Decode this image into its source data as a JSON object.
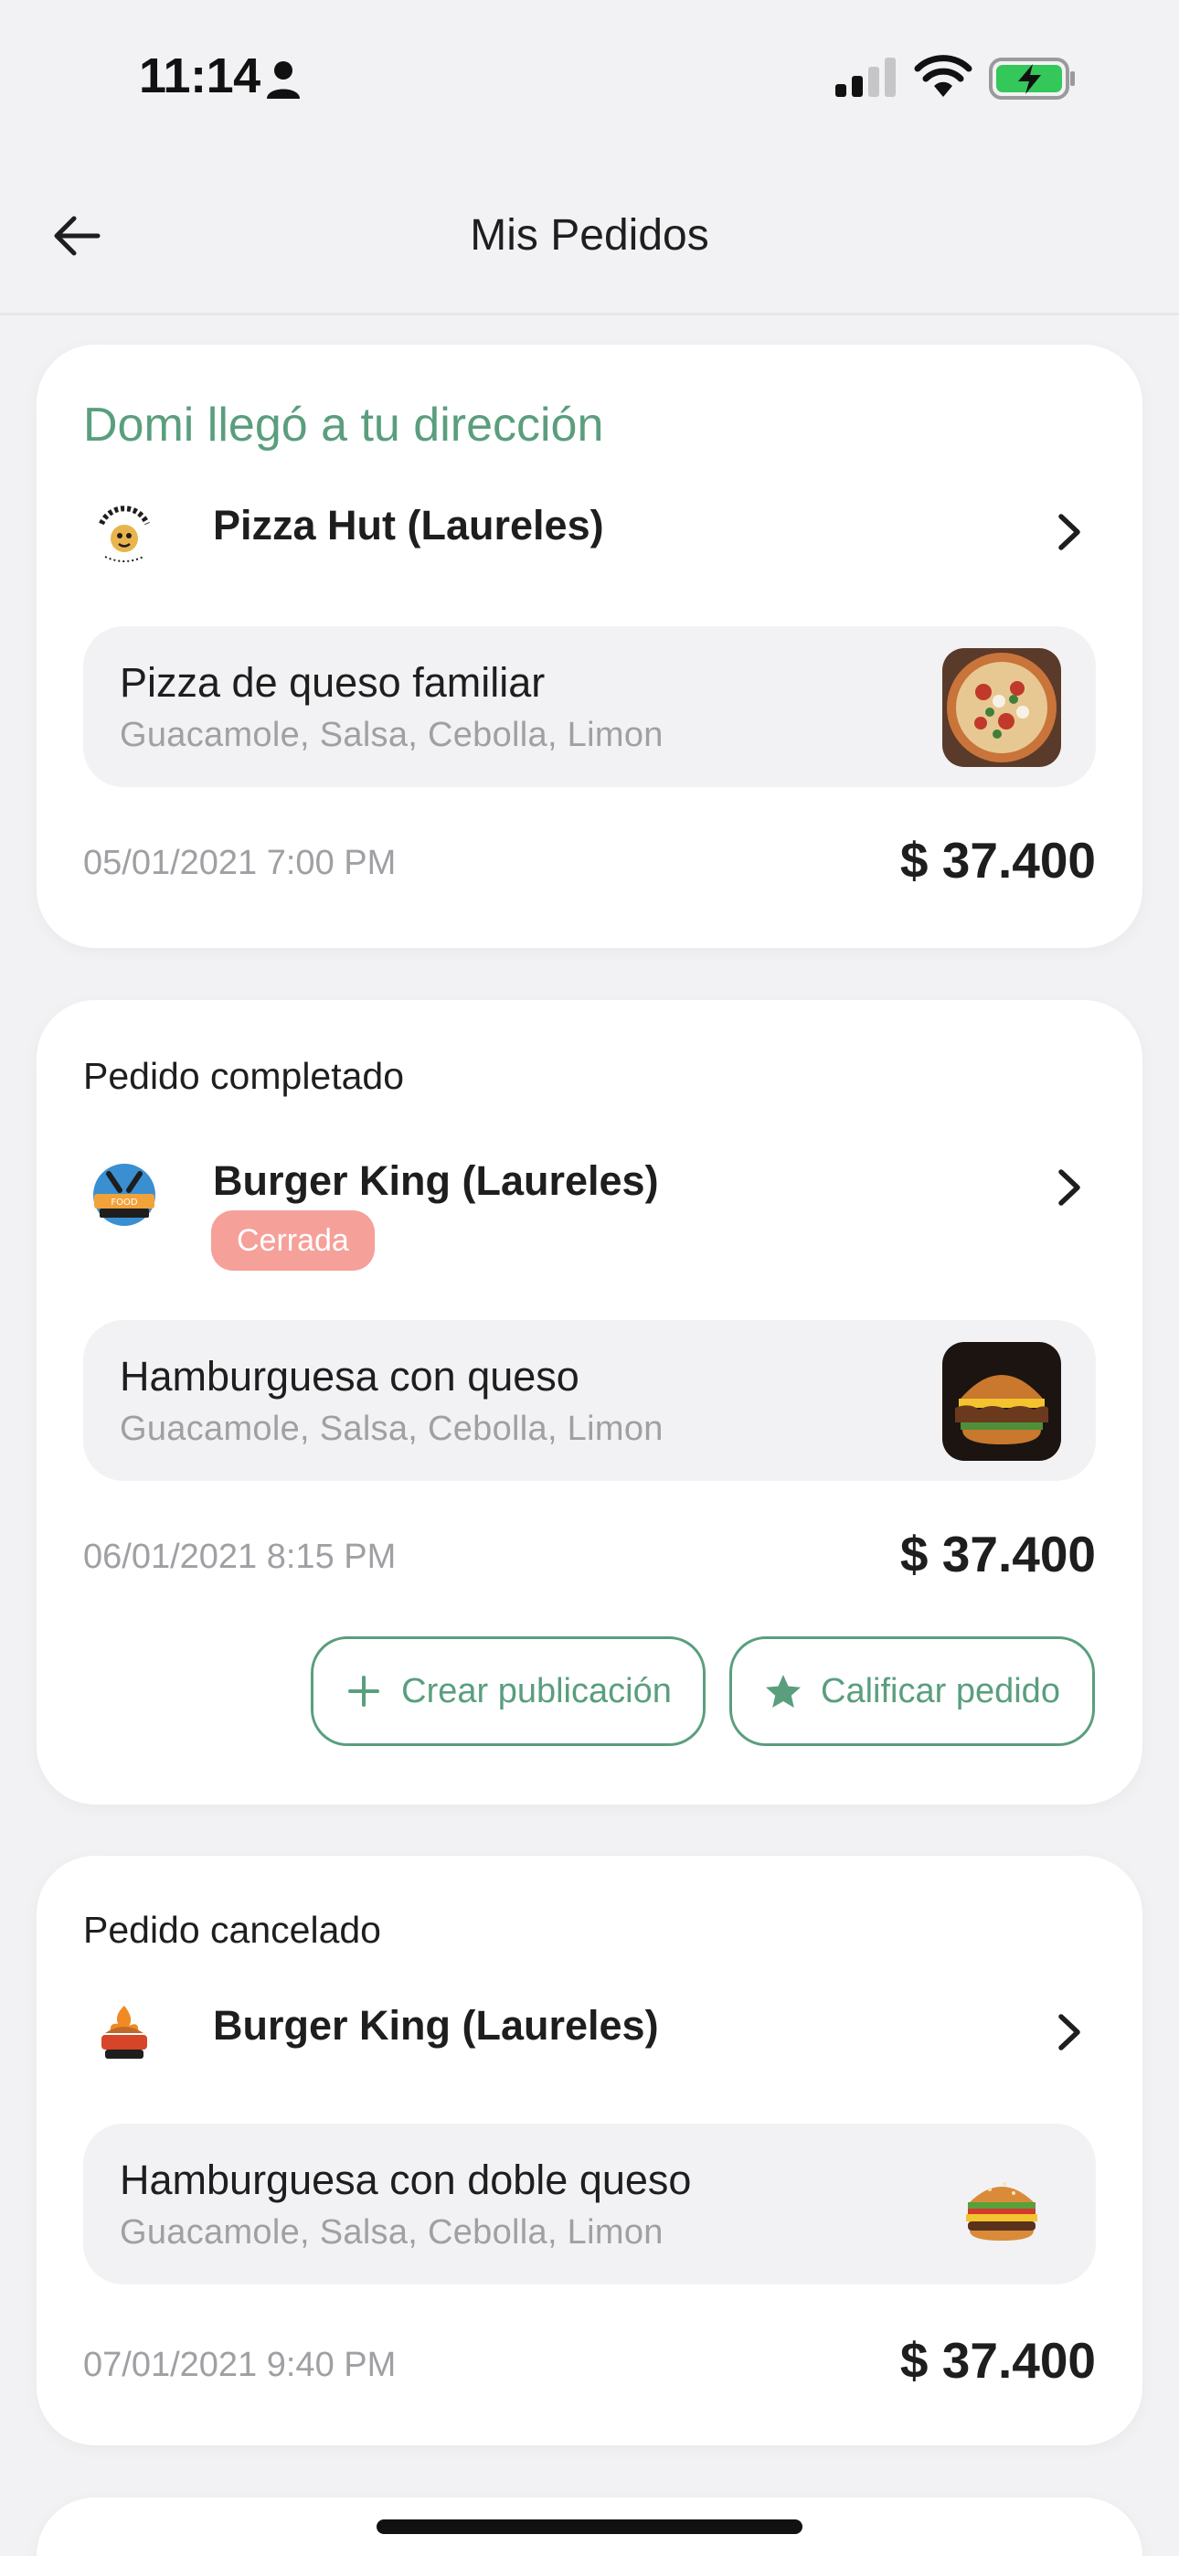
{
  "status_bar": {
    "time": "11:14"
  },
  "header": {
    "title": "Mis Pedidos"
  },
  "orders": [
    {
      "status": "Domi llegó a tu dirección",
      "store": "Pizza Hut (Laureles)",
      "item_name": "Pizza de queso familiar",
      "item_extras": "Guacamole, Salsa, Cebolla, Limon",
      "date": "05/01/2021 7:00 PM",
      "total": "$ 37.400"
    },
    {
      "status": "Pedido completado",
      "store": "Burger King (Laureles)",
      "badge": "Cerrada",
      "item_name": "Hamburguesa con queso",
      "item_extras": "Guacamole, Salsa, Cebolla, Limon",
      "date": "06/01/2021 8:15 PM",
      "total": "$ 37.400",
      "actions": {
        "create_post": "Crear publicación",
        "rate_order": "Calificar pedido"
      }
    },
    {
      "status": "Pedido cancelado",
      "store": "Burger King (Laureles)",
      "item_name": "Hamburguesa con doble queso",
      "item_extras": "Guacamole, Salsa, Cebolla, Limon",
      "date": "07/01/2021 9:40 PM",
      "total": "$ 37.400"
    }
  ],
  "colors": {
    "accent": "#5a9e7e",
    "badge_closed": "#f6a09a",
    "background": "#f2f2f4",
    "muted_text": "#a0a0a4"
  }
}
